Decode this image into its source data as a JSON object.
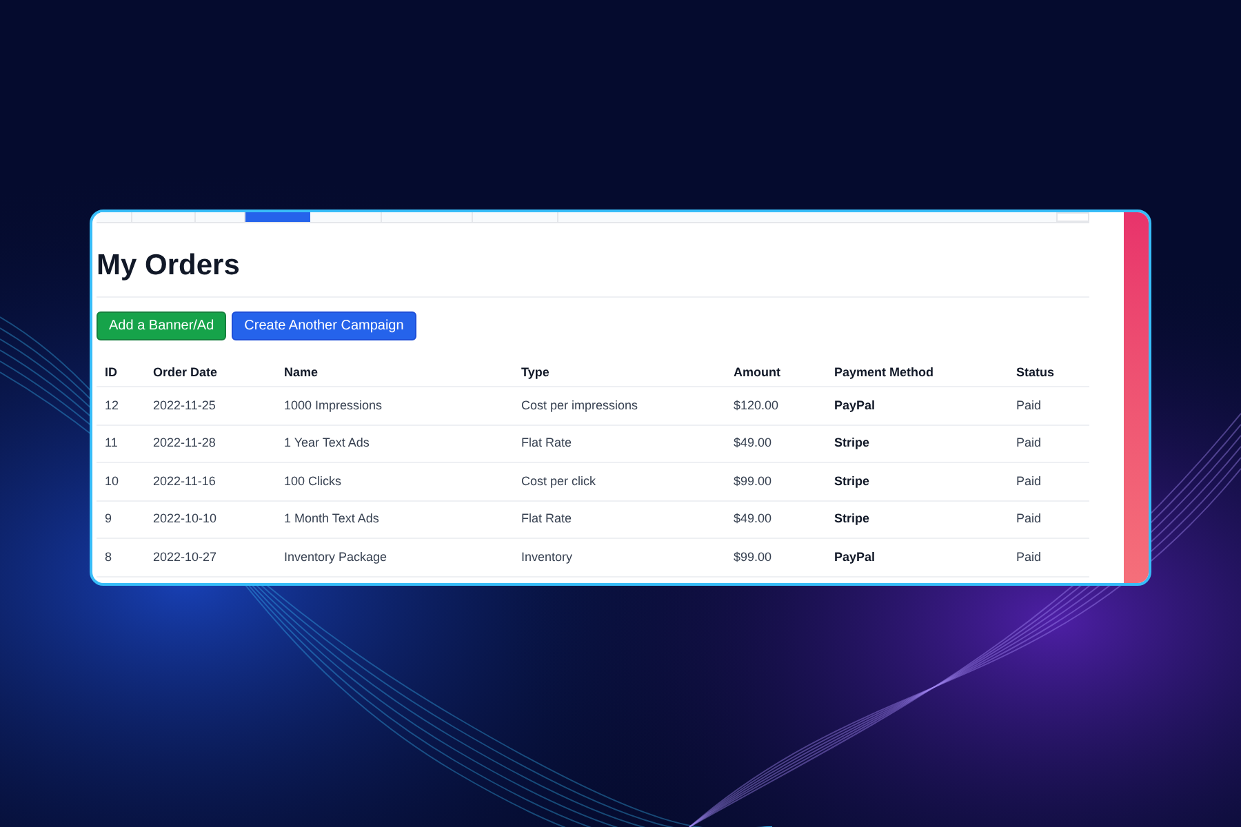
{
  "tabs": [
    {
      "selected": false
    },
    {
      "selected": false
    },
    {
      "selected": false
    },
    {
      "selected": true
    },
    {
      "selected": false
    },
    {
      "selected": false
    },
    {
      "selected": false
    }
  ],
  "title": "My Orders",
  "buttons": [
    {
      "label": "Add a Banner/Ad",
      "kind": "success"
    },
    {
      "label": "Create Another Campaign",
      "kind": "primary"
    }
  ],
  "table": {
    "columns": [
      "ID",
      "Order Date",
      "Name",
      "Type",
      "Amount",
      "Payment Method",
      "Status"
    ],
    "rows": [
      [
        "12",
        "2022-11-25",
        "1000 Impressions",
        "Cost per impressions",
        "$120.00",
        "PayPal",
        "Paid"
      ],
      [
        "11",
        "2022-11-28",
        "1 Year Text Ads",
        "Flat Rate",
        "$49.00",
        "Stripe",
        "Paid"
      ],
      [
        "10",
        "2022-11-16",
        "100 Clicks",
        "Cost per click",
        "$99.00",
        "Stripe",
        "Paid"
      ],
      [
        "9",
        "2022-10-10",
        "1 Month Text Ads",
        "Flat Rate",
        "$49.00",
        "Stripe",
        "Paid"
      ],
      [
        "8",
        "2022-10-27",
        "Inventory Package",
        "Inventory",
        "$99.00",
        "PayPal",
        "Paid"
      ]
    ]
  }
}
